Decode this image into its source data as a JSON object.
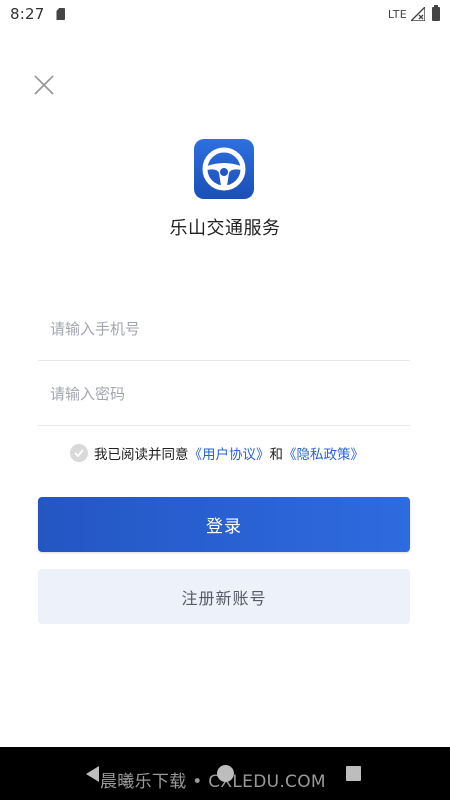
{
  "status_bar": {
    "time": "8:27",
    "network": "LTE"
  },
  "icons": {
    "close": "close-icon",
    "logo": "steering-wheel-icon",
    "check": "checkmark-icon"
  },
  "app": {
    "name": "乐山交通服务"
  },
  "form": {
    "phone_placeholder": "请输入手机号",
    "password_placeholder": "请输入密码"
  },
  "agreement": {
    "prefix": "我已阅读并同意",
    "user_agreement": "《用户协议》",
    "and": "和",
    "privacy_policy": "《隐私政策》"
  },
  "buttons": {
    "login": "登录",
    "register": "注册新账号"
  },
  "watermark": {
    "left": "晨曦乐下载",
    "dot": "•",
    "right": "CXLEDU.COM"
  },
  "colors": {
    "primary": "#2a63d4",
    "register_bg": "#ecf1fa",
    "placeholder": "#a3a6ad"
  }
}
